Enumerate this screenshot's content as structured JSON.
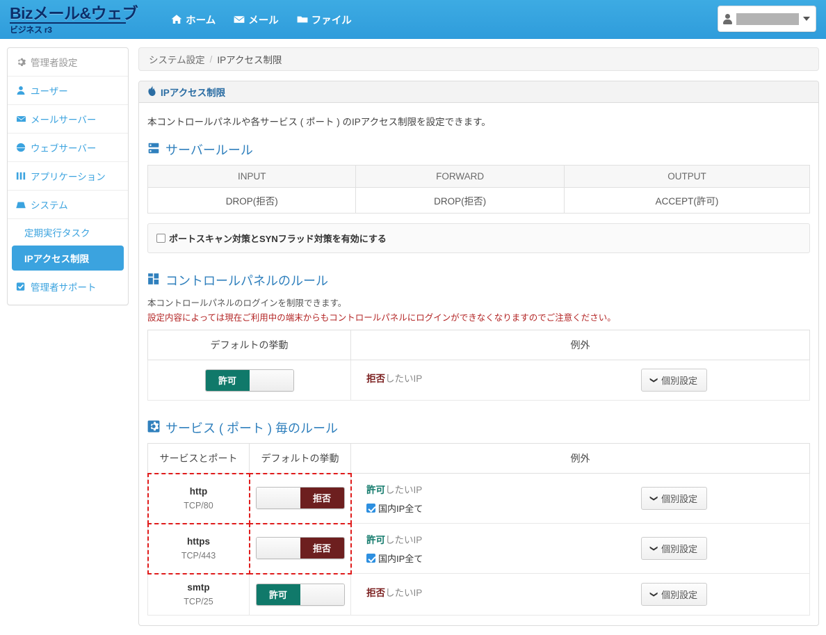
{
  "header": {
    "brand_main": "Bizメール&ウェブ",
    "brand_sub": "ビジネス r3",
    "nav": [
      {
        "label": "ホーム",
        "icon": "home-icon"
      },
      {
        "label": "メール",
        "icon": "envelope-icon"
      },
      {
        "label": "ファイル",
        "icon": "folder-icon"
      }
    ],
    "user": {
      "icon": "user-icon",
      "name": "",
      "caret": "chevron-down-icon"
    }
  },
  "sidebar": {
    "items": [
      {
        "label": "管理者設定",
        "icon": "gear-icon",
        "type": "head",
        "active": false
      },
      {
        "label": "ユーザー",
        "icon": "user-icon",
        "type": "item",
        "active": false
      },
      {
        "label": "メールサーバー",
        "icon": "envelope-icon",
        "type": "item",
        "active": false
      },
      {
        "label": "ウェブサーバー",
        "icon": "globe-icon",
        "type": "item",
        "active": false
      },
      {
        "label": "アプリケーション",
        "icon": "grid-icon",
        "type": "item",
        "active": false
      },
      {
        "label": "システム",
        "icon": "server-icon",
        "type": "item",
        "active": false
      },
      {
        "label": "定期実行タスク",
        "icon": "",
        "type": "sub",
        "active": false
      },
      {
        "label": "IPアクセス制限",
        "icon": "",
        "type": "sub",
        "active": true
      },
      {
        "label": "管理者サポート",
        "icon": "check-square-icon",
        "type": "item",
        "active": false
      }
    ]
  },
  "breadcrumb": {
    "parent": "システム設定",
    "separator": "/",
    "current": "IPアクセス制限"
  },
  "panel": {
    "title": "IPアクセス制限",
    "title_icon": "fire-icon",
    "intro": "本コントロールパネルや各サービス ( ポート ) のIPアクセス制限を設定できます。"
  },
  "server_rules": {
    "title": "サーバールール",
    "icon": "server-icon",
    "columns": [
      "INPUT",
      "FORWARD",
      "OUTPUT"
    ],
    "values": [
      "DROP(拒否)",
      "DROP(拒否)",
      "ACCEPT(許可)"
    ],
    "checkbox": {
      "label": "ポートスキャン対策とSYNフラッド対策を有効にする",
      "checked": false
    }
  },
  "panel_rules": {
    "title": "コントロールパネルのルール",
    "icon": "grid-icon",
    "desc": "本コントロールパネルのログインを制限できます。",
    "warn": "設定内容によっては現在ご利用中の端末からもコントロールパネルにログインができなくなりますのでご注意ください。",
    "columns": [
      "デフォルトの挙動",
      "例外"
    ],
    "row": {
      "toggle": {
        "state": "allow",
        "label_allow": "許可",
        "label_deny": "拒否"
      },
      "exception_keyword": "拒否",
      "exception_suffix": "したいIP",
      "button": "個別設定"
    }
  },
  "service_rules": {
    "title": "サービス ( ポート ) 毎のルール",
    "icon": "gear-square-icon",
    "columns": [
      "サービスとポート",
      "デフォルトの挙動",
      "例外"
    ],
    "domestic_label": "国内IP全て",
    "button": "個別設定",
    "rows": [
      {
        "service": "http",
        "port": "TCP/80",
        "toggle_state": "deny",
        "toggle_label_allow": "許可",
        "toggle_label_deny": "拒否",
        "exception_keyword": "許可",
        "exception_suffix": "したいIP",
        "domestic_checked": true,
        "highlighted": true
      },
      {
        "service": "https",
        "port": "TCP/443",
        "toggle_state": "deny",
        "toggle_label_allow": "許可",
        "toggle_label_deny": "拒否",
        "exception_keyword": "許可",
        "exception_suffix": "したいIP",
        "domestic_checked": true,
        "highlighted": true
      },
      {
        "service": "smtp",
        "port": "TCP/25",
        "toggle_state": "allow",
        "toggle_label_allow": "許可",
        "toggle_label_deny": "拒否",
        "exception_keyword": "拒否",
        "exception_suffix": "したいIP",
        "domestic_checked": false,
        "highlighted": false
      }
    ]
  },
  "colors": {
    "header_blue": "#33a2df",
    "accent_blue": "#3ba3df",
    "section_title": "#3080bd",
    "allow_green": "#10796a",
    "deny_red": "#6d1f1f",
    "warn_red": "#b32525",
    "highlight_dashed": "#e01b1b"
  }
}
